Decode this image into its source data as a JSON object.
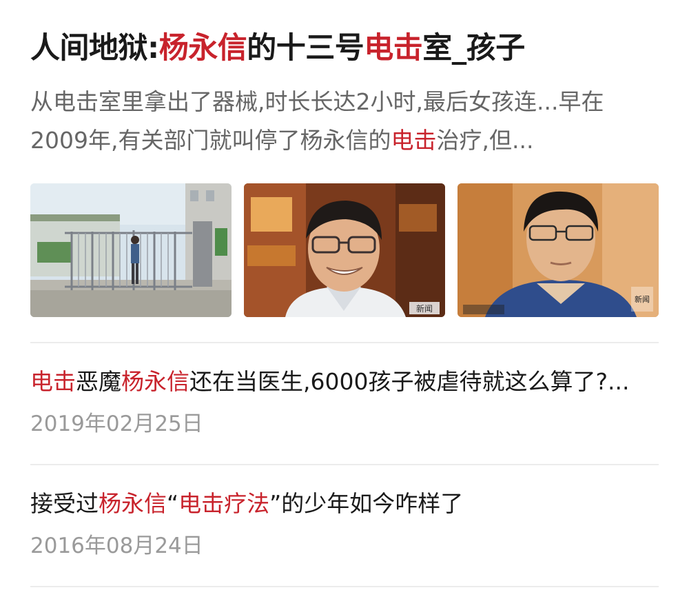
{
  "results": [
    {
      "title": {
        "p1": "人间地狱:",
        "h1": "杨永信",
        "p2": "的十三号",
        "h2": "电击",
        "p3": "室_孩子"
      },
      "snippet": {
        "line1": "从电击室里拿出了器械,时长长达2小时,最后女孩连...早在",
        "line2": "2009年,有关部门就叫停了杨永信的",
        "line2_hl": "电击",
        "line2_end": "治疗,但..."
      },
      "thumbnails": [
        {
          "caption": ""
        },
        {
          "caption": "新闻"
        },
        {
          "caption": "新闻"
        }
      ]
    },
    {
      "title": {
        "h1": "电击",
        "p1": "恶魔",
        "h2": "杨永信",
        "p2": "还在当医生,6000孩子被虐待就这么算了?..."
      },
      "date": "2019年02月25日"
    },
    {
      "title": {
        "p1": "接受过",
        "h1": "杨永信",
        "p2": "“",
        "h2": "电击疗法",
        "p3": "”的少年如今咋样了"
      },
      "date": "2016年08月24日"
    }
  ],
  "colors": {
    "highlight": "#c8232c",
    "title": "#1a1a1a",
    "snippet": "#666666",
    "date": "#9a9a9a",
    "divider": "#ececec"
  }
}
